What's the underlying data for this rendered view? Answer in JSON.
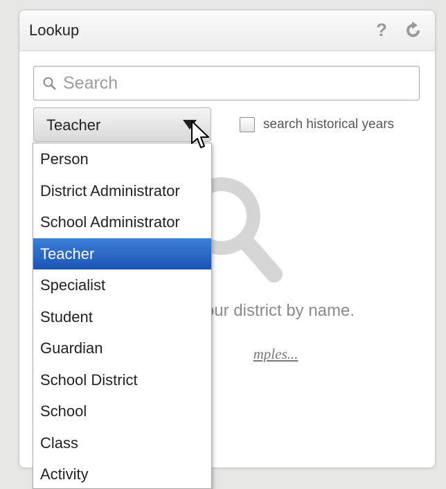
{
  "header": {
    "title": "Lookup",
    "help_icon": "?",
    "refresh_icon": "refresh-icon"
  },
  "search": {
    "placeholder": "Search",
    "value": ""
  },
  "role_select": {
    "selected": "Teacher",
    "options": [
      "Person",
      "District Administrator",
      "School Administrator",
      "Teacher",
      "Specialist",
      "Student",
      "Guardian",
      "School District",
      "School",
      "Class",
      "Activity"
    ]
  },
  "historical": {
    "label": "search historical years",
    "checked": false
  },
  "empty_state": {
    "message": "your district by name.",
    "link": "mples..."
  },
  "colors": {
    "selection": "#1f5fc0",
    "panel_bg": "#ffffff",
    "page_bg": "#e6e6e4"
  }
}
